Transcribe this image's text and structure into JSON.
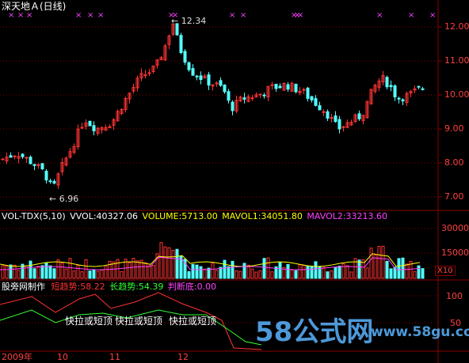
{
  "header": {
    "title": "深天地Ａ(日线)"
  },
  "markers": {
    "symbol": "×"
  },
  "price_panel": {
    "y_ticks": [
      "12.00",
      "11.00",
      "10.00",
      "9.00",
      "8.00",
      "7.00"
    ],
    "high_label": "12.34",
    "low_label": "6.96"
  },
  "volume_panel": {
    "indicator": "VOL-TDX(5,10)",
    "vvol": "VVOL:40327.06",
    "volume": "VOLUME:5713.00",
    "mavol1": "MAVOL1:34051.80",
    "mavol2": "MAVOL2:33213.60",
    "y_ticks": [
      "30000",
      "15000"
    ],
    "unit": "X10"
  },
  "indicator_panel": {
    "name": "股旁网制作",
    "short": "短趋势:58.22",
    "long": "长趋势:54.39",
    "judge": "判断底:0.00",
    "annot1": "快拉或短顶",
    "annot2": "快拉或短顶",
    "annot3": "快拉或短顶",
    "y_ticks": [
      "100",
      "50"
    ]
  },
  "time_axis": [
    "2009年",
    "10",
    "11",
    "12"
  ],
  "watermark": {
    "brand": "58公式网",
    "url": "www.58gu.com"
  },
  "colors": {
    "up": "#ff3333",
    "down": "#54ffff",
    "grid": "#8b0000",
    "vol_ma1": "#ffff00",
    "vol_ma2": "#ff40ff",
    "short": "#ff3333",
    "long": "#33ff33"
  }
}
